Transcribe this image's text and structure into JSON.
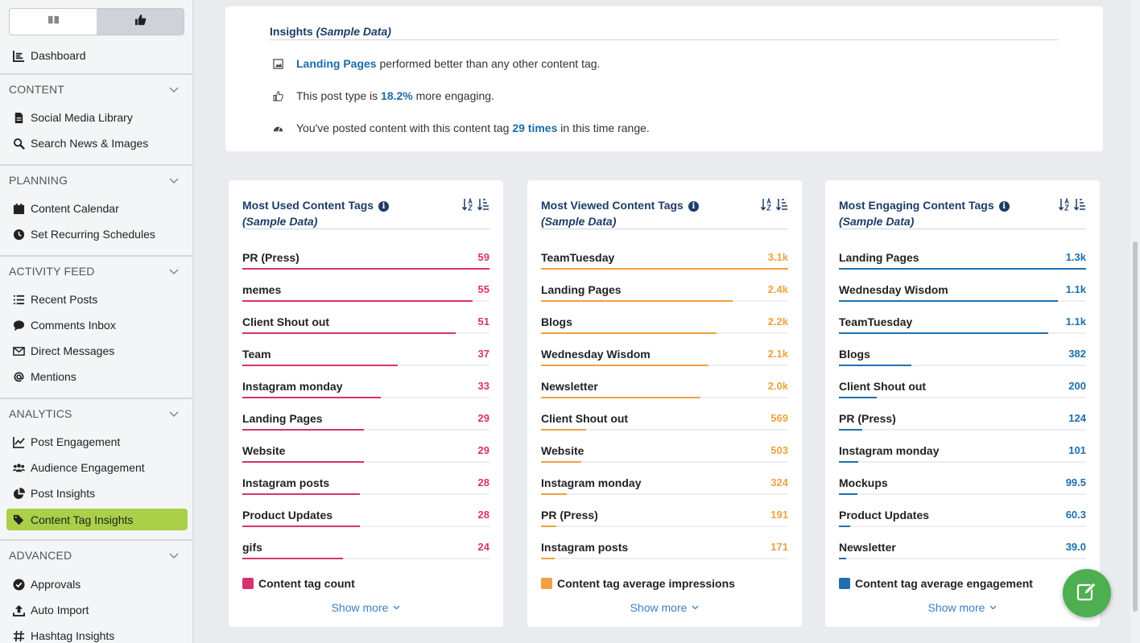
{
  "sidebar": {
    "toggle": {
      "left_icon": "book-icon",
      "right_icon": "thumbs-up-icon"
    },
    "dashboard": {
      "label": "Dashboard",
      "icon": "chart-icon"
    },
    "sections": [
      {
        "title": "CONTENT",
        "items": [
          {
            "label": "Social Media Library",
            "icon": "file-icon"
          },
          {
            "label": "Search News & Images",
            "icon": "search-icon"
          }
        ]
      },
      {
        "title": "PLANNING",
        "items": [
          {
            "label": "Content Calendar",
            "icon": "calendar-icon"
          },
          {
            "label": "Set Recurring Schedules",
            "icon": "clock-icon"
          }
        ]
      },
      {
        "title": "ACTIVITY FEED",
        "items": [
          {
            "label": "Recent Posts",
            "icon": "list-icon"
          },
          {
            "label": "Comments Inbox",
            "icon": "comment-icon"
          },
          {
            "label": "Direct Messages",
            "icon": "envelope-icon"
          },
          {
            "label": "Mentions",
            "icon": "at-icon"
          }
        ]
      },
      {
        "title": "ANALYTICS",
        "items": [
          {
            "label": "Post Engagement",
            "icon": "line-chart-icon"
          },
          {
            "label": "Audience Engagement",
            "icon": "users-icon"
          },
          {
            "label": "Post Insights",
            "icon": "pie-chart-icon"
          },
          {
            "label": "Content Tag Insights",
            "icon": "tags-icon",
            "active": true
          }
        ]
      },
      {
        "title": "ADVANCED",
        "items": [
          {
            "label": "Approvals",
            "icon": "check-circle-icon"
          },
          {
            "label": "Auto Import",
            "icon": "upload-icon"
          },
          {
            "label": "Hashtag Insights",
            "icon": "hashtag-icon"
          }
        ]
      }
    ]
  },
  "insights": {
    "title": "Insights",
    "title_sub": "(Sample Data)",
    "rows": [
      {
        "icon": "image-icon",
        "highlight": "Landing Pages",
        "text": " performed better than any other content tag."
      },
      {
        "icon": "thumbs-up-icon",
        "pre": "This post type is ",
        "highlight": "18.2%",
        "post": " more engaging."
      },
      {
        "icon": "dashboard-icon",
        "pre": "You've posted content with this content tag ",
        "highlight": "29 times",
        "post": " in this time range."
      }
    ]
  },
  "cards": [
    {
      "title": "Most Used Content Tags",
      "subtitle": "(Sample Data)",
      "color": "#d6336c",
      "legend": "Content tag count",
      "show_more": "Show more",
      "rows": [
        {
          "label": "PR (Press)",
          "value": "59",
          "num": 59
        },
        {
          "label": "memes",
          "value": "55",
          "num": 55
        },
        {
          "label": "Client Shout out",
          "value": "51",
          "num": 51
        },
        {
          "label": "Team",
          "value": "37",
          "num": 37
        },
        {
          "label": "Instagram monday",
          "value": "33",
          "num": 33
        },
        {
          "label": "Landing Pages",
          "value": "29",
          "num": 29
        },
        {
          "label": "Website",
          "value": "29",
          "num": 29
        },
        {
          "label": "Instagram posts",
          "value": "28",
          "num": 28
        },
        {
          "label": "Product Updates",
          "value": "28",
          "num": 28
        },
        {
          "label": "gifs",
          "value": "24",
          "num": 24
        }
      ]
    },
    {
      "title": "Most Viewed Content Tags",
      "subtitle": "(Sample Data)",
      "color": "#f0a040",
      "legend": "Content tag average impressions",
      "show_more": "Show more",
      "rows": [
        {
          "label": "TeamTuesday",
          "value": "3.1k",
          "num": 3100
        },
        {
          "label": "Landing Pages",
          "value": "2.4k",
          "num": 2400
        },
        {
          "label": "Blogs",
          "value": "2.2k",
          "num": 2200
        },
        {
          "label": "Wednesday Wisdom",
          "value": "2.1k",
          "num": 2100
        },
        {
          "label": "Newsletter",
          "value": "2.0k",
          "num": 2000
        },
        {
          "label": "Client Shout out",
          "value": "569",
          "num": 569
        },
        {
          "label": "Website",
          "value": "503",
          "num": 503
        },
        {
          "label": "Instagram monday",
          "value": "324",
          "num": 324
        },
        {
          "label": "PR (Press)",
          "value": "191",
          "num": 191
        },
        {
          "label": "Instagram posts",
          "value": "171",
          "num": 171
        }
      ]
    },
    {
      "title": "Most Engaging Content Tags",
      "subtitle": "(Sample Data)",
      "color": "#1f6fae",
      "legend": "Content tag average engagement",
      "show_more": "Show more",
      "rows": [
        {
          "label": "Landing Pages",
          "value": "1.3k",
          "num": 1300
        },
        {
          "label": "Wednesday Wisdom",
          "value": "1.1k",
          "num": 1150
        },
        {
          "label": "TeamTuesday",
          "value": "1.1k",
          "num": 1100
        },
        {
          "label": "Blogs",
          "value": "382",
          "num": 382
        },
        {
          "label": "Client Shout out",
          "value": "200",
          "num": 200
        },
        {
          "label": "PR (Press)",
          "value": "124",
          "num": 124
        },
        {
          "label": "Instagram monday",
          "value": "101",
          "num": 101
        },
        {
          "label": "Mockups",
          "value": "99.5",
          "num": 99.5
        },
        {
          "label": "Product Updates",
          "value": "60.3",
          "num": 60.3
        },
        {
          "label": "Newsletter",
          "value": "39.0",
          "num": 39.0
        }
      ]
    }
  ],
  "fab": {
    "icon": "edit-icon",
    "color": "#4caf50"
  }
}
